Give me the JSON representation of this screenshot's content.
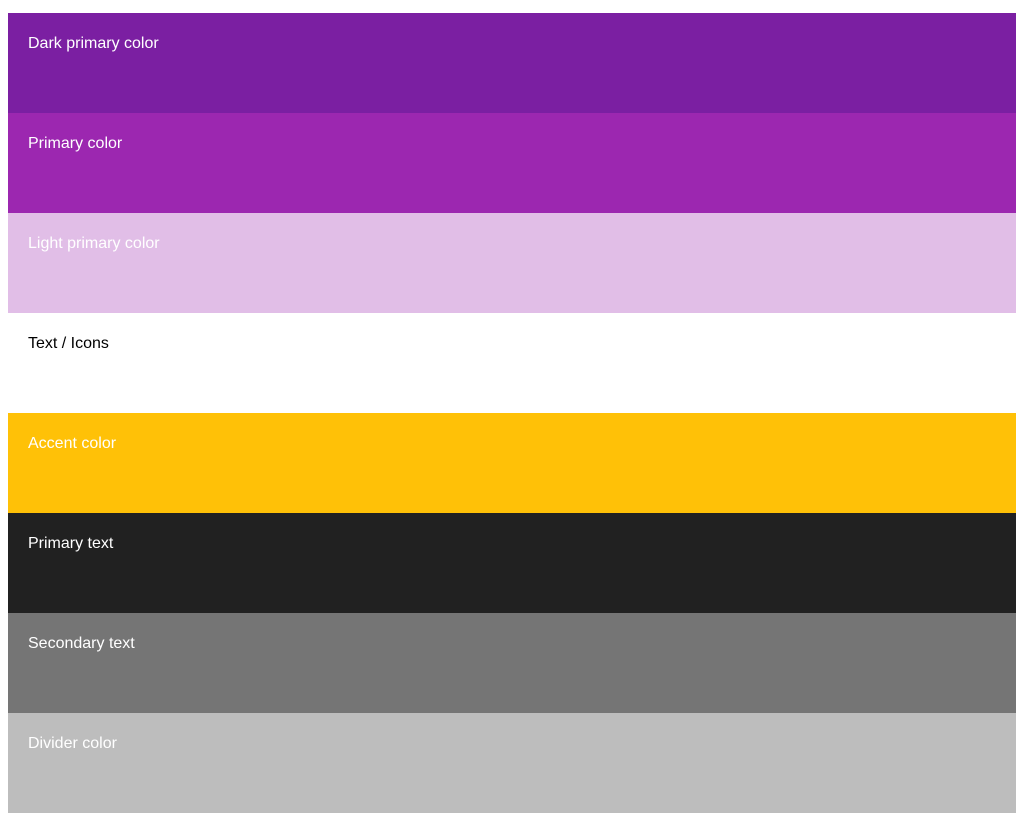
{
  "palette": [
    {
      "label": "Dark primary color",
      "color": "#7b1fa2",
      "text_color": "#ffffff"
    },
    {
      "label": "Primary color",
      "color": "#9c27b0",
      "text_color": "#ffffff"
    },
    {
      "label": "Light primary color",
      "color": "#e1bee7",
      "text_color": "#ffffff"
    },
    {
      "label": "Text / Icons",
      "color": "#ffffff",
      "text_color": "#000000"
    },
    {
      "label": "Accent color",
      "color": "#ffc107",
      "text_color": "#ffffff"
    },
    {
      "label": "Primary text",
      "color": "#212121",
      "text_color": "#ffffff"
    },
    {
      "label": "Secondary text",
      "color": "#757575",
      "text_color": "#ffffff"
    },
    {
      "label": "Divider color",
      "color": "#bdbdbd",
      "text_color": "#ffffff"
    }
  ]
}
